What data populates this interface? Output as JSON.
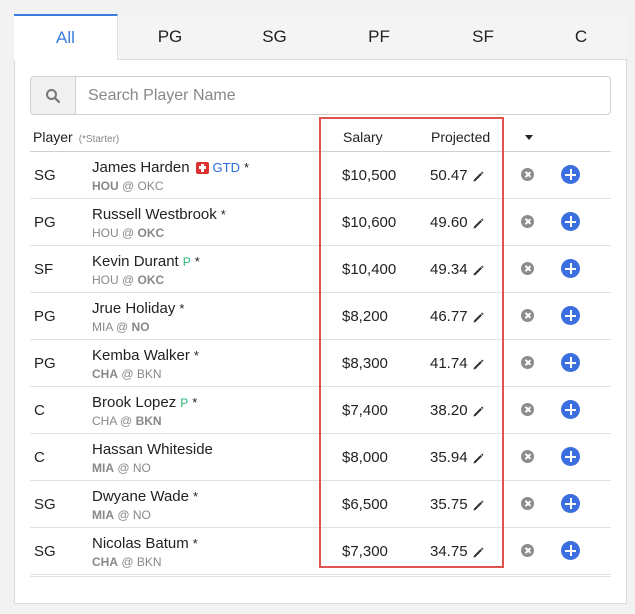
{
  "tabs": [
    {
      "label": "All",
      "active": true
    },
    {
      "label": "PG"
    },
    {
      "label": "SG"
    },
    {
      "label": "PF"
    },
    {
      "label": "SF"
    },
    {
      "label": "C"
    }
  ],
  "search": {
    "placeholder": "Search Player Name",
    "icon": "search-icon"
  },
  "columns": {
    "player": "Player",
    "starter_note": "(*Starter)",
    "salary": "Salary",
    "projected": "Projected"
  },
  "colors": {
    "accent": "#3a7be0",
    "highlight": "#e0534f",
    "add": "#3b6fe0",
    "remove": "#8c8c8c",
    "probable": "#2bb673",
    "injury": "#e03131"
  },
  "players": [
    {
      "pos": "SG",
      "name": "James Harden",
      "status": "GTD",
      "injury": true,
      "starter": "*",
      "team": "HOU",
      "at": "@",
      "opp": "OKC",
      "bold": "team",
      "salary": "$10,500",
      "projected": "50.47"
    },
    {
      "pos": "PG",
      "name": "Russell Westbrook",
      "starter": "*",
      "team": "HOU",
      "at": "@",
      "opp": "OKC",
      "bold": "opp",
      "salary": "$10,600",
      "projected": "49.60"
    },
    {
      "pos": "SF",
      "name": "Kevin Durant",
      "probable": "P",
      "starter": "*",
      "team": "HOU",
      "at": "@",
      "opp": "OKC",
      "bold": "opp",
      "salary": "$10,400",
      "projected": "49.34"
    },
    {
      "pos": "PG",
      "name": "Jrue Holiday",
      "starter": "*",
      "team": "MIA",
      "at": "@",
      "opp": "NO",
      "bold": "opp",
      "salary": "$8,200",
      "projected": "46.77"
    },
    {
      "pos": "PG",
      "name": "Kemba Walker",
      "starter": "*",
      "team": "CHA",
      "at": "@",
      "opp": "BKN",
      "bold": "team",
      "salary": "$8,300",
      "projected": "41.74"
    },
    {
      "pos": "C",
      "name": "Brook Lopez",
      "probable": "P",
      "starter": "*",
      "team": "CHA",
      "at": "@",
      "opp": "BKN",
      "bold": "opp",
      "salary": "$7,400",
      "projected": "38.20"
    },
    {
      "pos": "C",
      "name": "Hassan Whiteside",
      "starter": "",
      "team": "MIA",
      "at": "@",
      "opp": "NO",
      "bold": "team",
      "salary": "$8,000",
      "projected": "35.94"
    },
    {
      "pos": "SG",
      "name": "Dwyane Wade",
      "starter": "*",
      "team": "MIA",
      "at": "@",
      "opp": "NO",
      "bold": "team",
      "salary": "$6,500",
      "projected": "35.75"
    },
    {
      "pos": "SG",
      "name": "Nicolas Batum",
      "starter": "*",
      "team": "CHA",
      "at": "@",
      "opp": "BKN",
      "bold": "team",
      "salary": "$7,300",
      "projected": "34.75"
    }
  ]
}
